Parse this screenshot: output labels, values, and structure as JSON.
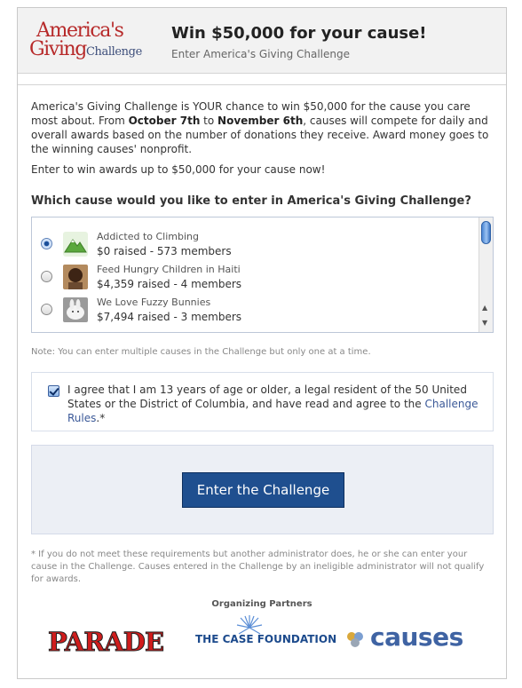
{
  "header": {
    "logo_line1": "America's",
    "logo_line2a": "Giving",
    "logo_line2b": "Challenge",
    "title": "Win $50,000 for your cause!",
    "subtitle": "Enter America's Giving Challenge"
  },
  "intro": {
    "p1_start": "America's Giving Challenge is YOUR chance to win $50,000 for the cause you care most about. From ",
    "start_date": "October 7th",
    "p1_mid": " to ",
    "end_date": "November 6th",
    "p1_end": ", causes will compete for daily and overall awards based on the number of donations they receive. Award money goes to the winning causes' nonprofit.",
    "p2": "Enter to win awards up to $50,000 for your cause now!"
  },
  "question": "Which cause would you like to enter in America's Giving Challenge?",
  "causes": [
    {
      "name": "Addicted to Climbing",
      "meta": "$0 raised - 573 members",
      "selected": true,
      "icon": "mountain-thumbnail"
    },
    {
      "name": "Feed Hungry Children in Haiti",
      "meta": "$4,359 raised - 4 members",
      "selected": false,
      "icon": "child-photo-thumbnail"
    },
    {
      "name": "We Love Fuzzy Bunnies",
      "meta": "$7,494 raised - 3 members",
      "selected": false,
      "icon": "bunny-photo-thumbnail"
    }
  ],
  "note": "Note: You can enter multiple causes in the Challenge but only one at a time.",
  "agreement": {
    "checked": true,
    "text": "I agree that I am 13 years of age or older, a legal resident of the 50 United States or the District of Columbia, and have read and agree to the ",
    "link": "Challenge Rules",
    "suffix": ".*"
  },
  "cta_label": "Enter the Challenge",
  "footnote": "* If you do not meet these requirements but another administrator does, he or she can enter your cause in the Challenge. Causes entered in the Challenge by an ineligible administrator will not qualify for awards.",
  "partners": {
    "heading": "Organizing Partners",
    "parade": "PARADE",
    "case": "THE CASE FOUNDATION",
    "causes": "causes"
  },
  "colors": {
    "brand_red": "#b72a2a",
    "brand_blue": "#3b5998",
    "button_blue": "#1f4f8f",
    "panel_bg": "#eceff5"
  }
}
